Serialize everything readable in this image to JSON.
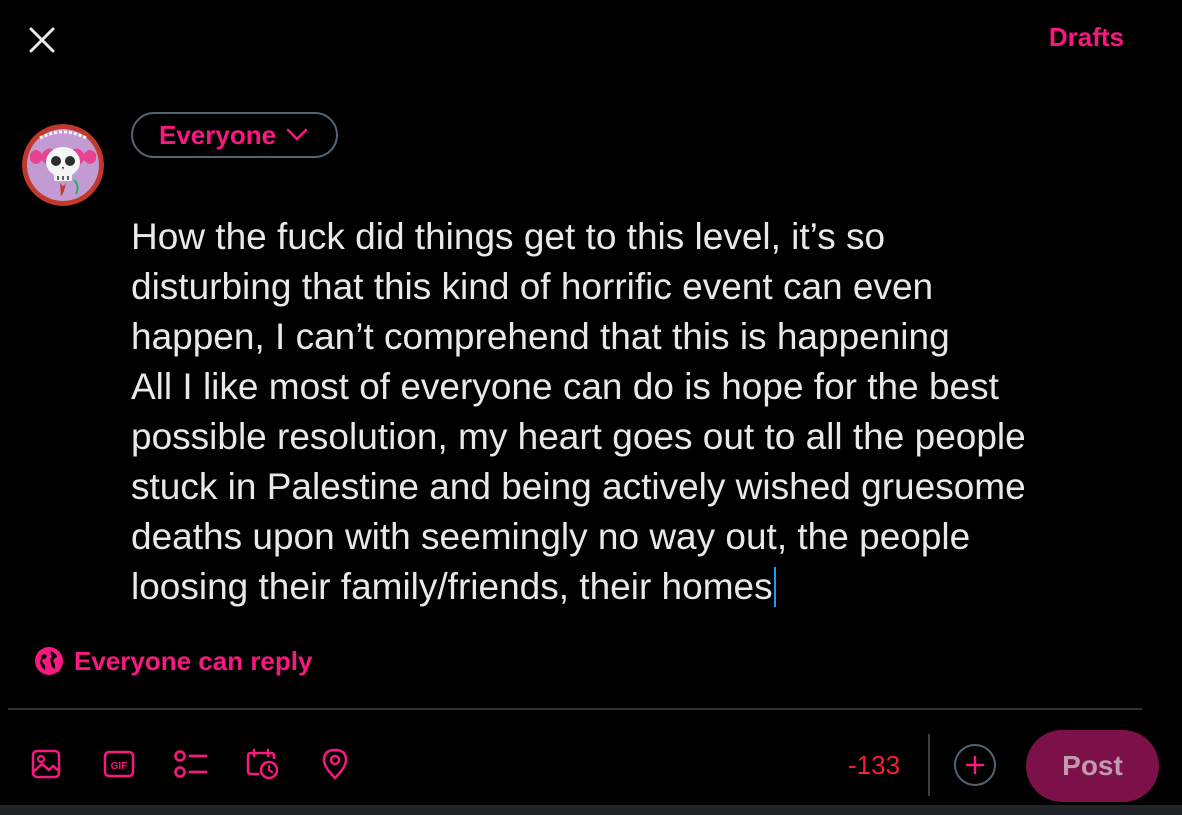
{
  "header": {
    "drafts_label": "Drafts"
  },
  "audience": {
    "label": "Everyone"
  },
  "compose": {
    "lines": [
      "How the fuck did things get to this level, it’s so",
      "disturbing that this kind of horrific event can even",
      "happen, I can’t comprehend that this is happening",
      "All I like most of everyone can do is hope for the best",
      "possible resolution, my heart goes out to all the people",
      "stuck in Palestine and being actively wished gruesome",
      "deaths upon with seemingly no way out, the people",
      "loosing their family/friends, their homes"
    ]
  },
  "reply_setting": {
    "label": "Everyone can reply",
    "icon": "globe-icon"
  },
  "toolbar": {
    "icons": [
      "image-icon",
      "gif-icon",
      "poll-icon",
      "schedule-icon",
      "location-icon"
    ],
    "char_count": "-133",
    "post_label": "Post"
  },
  "colors": {
    "accent": "#f91880",
    "post_bg_disabled": "#7c1048",
    "count_over": "#f4212e",
    "caret": "#1d9bf0"
  }
}
